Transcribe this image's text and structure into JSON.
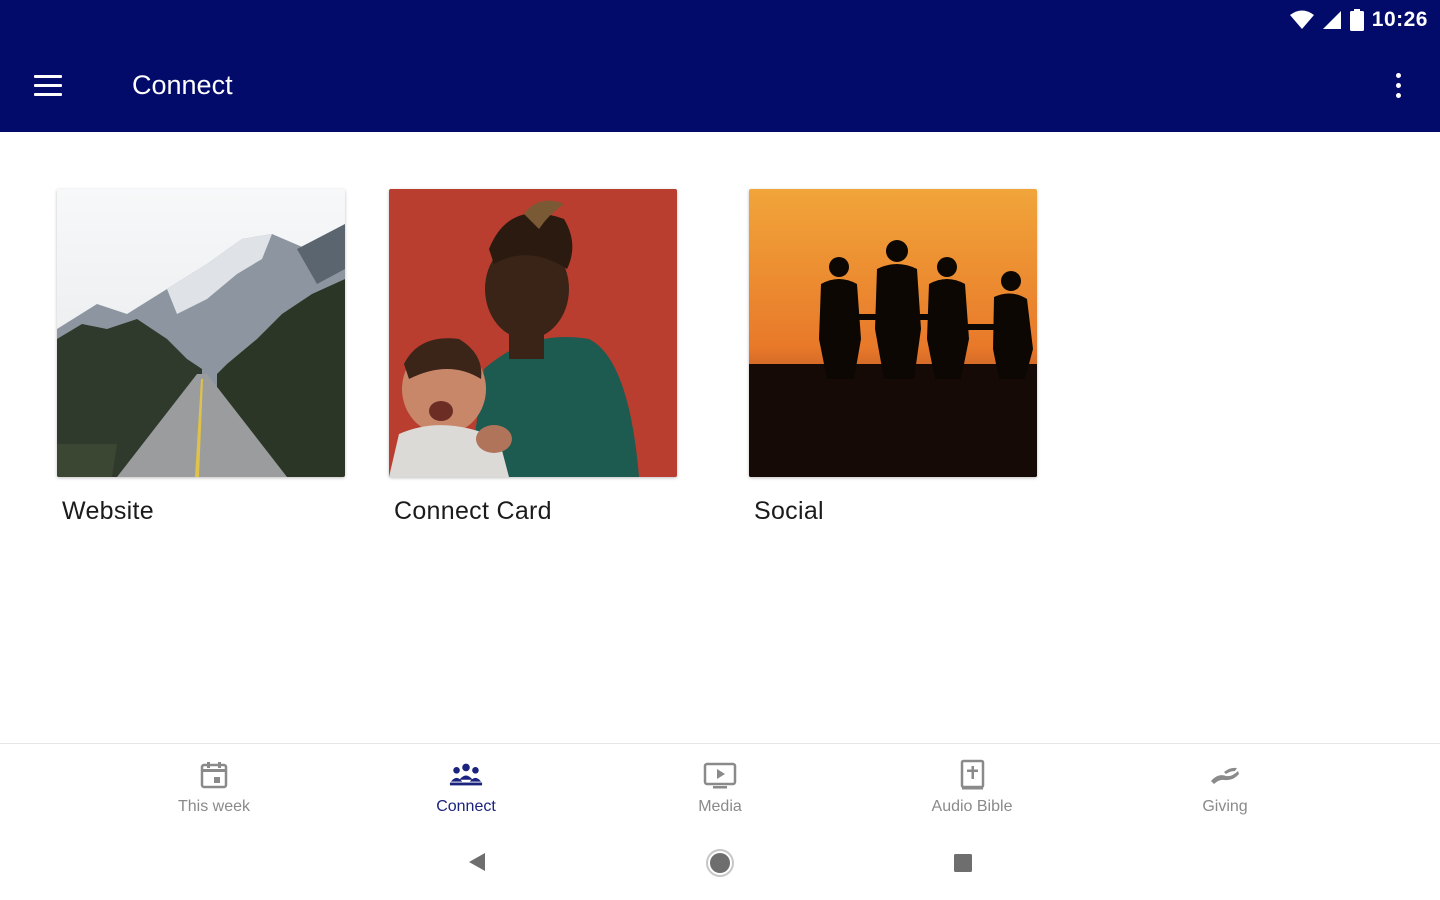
{
  "status_bar": {
    "time": "10:26",
    "icons": [
      "wifi-icon",
      "signal-icon",
      "battery-icon"
    ]
  },
  "app_bar": {
    "title": "Connect",
    "menu_icon": "hamburger-menu-icon",
    "overflow_icon": "more-vertical-icon"
  },
  "tiles": [
    {
      "label": "Website",
      "image": "mountain-road-photo"
    },
    {
      "label": "Connect Card",
      "image": "father-with-baby-photo"
    },
    {
      "label": "Social",
      "image": "family-sunset-silhouette-photo"
    }
  ],
  "bottom_nav": {
    "items": [
      {
        "label": "This week",
        "icon": "calendar-icon",
        "active": false
      },
      {
        "label": "Connect",
        "icon": "people-group-icon",
        "active": true
      },
      {
        "label": "Media",
        "icon": "play-screen-icon",
        "active": false
      },
      {
        "label": "Audio Bible",
        "icon": "bible-icon",
        "active": false
      },
      {
        "label": "Giving",
        "icon": "giving-hand-icon",
        "active": false
      }
    ]
  },
  "system_nav": [
    "back-icon",
    "home-icon",
    "recents-icon"
  ],
  "colors": {
    "app_bar": "#020a6a",
    "active_nav": "#1a237e",
    "inactive_nav": "#8a8a8a"
  }
}
